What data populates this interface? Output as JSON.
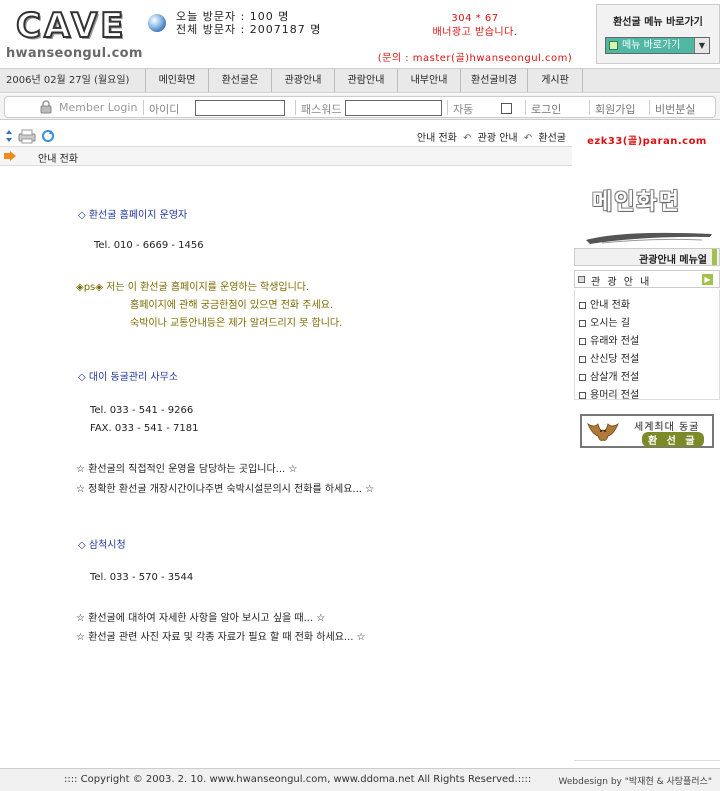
{
  "header": {
    "logo_text": "CAVE",
    "logo_domain": "hwanseongul.com",
    "visitors": {
      "today_label": "오늘 방문자 : ",
      "today_value": "100 명",
      "total_label": "전체 방문자 : ",
      "total_value": "2007187 명"
    },
    "ad": {
      "size": "304 * 67",
      "text": "배너광고 받습니다.",
      "contact": "(문의 : master(골)hwanseongul.com)"
    },
    "menu_shortcut": {
      "title": "환선굴 메뉴 바로가기",
      "selected": "메뉴 바로가기"
    }
  },
  "nav": {
    "date": "2006년 02월 27일 (월요일)",
    "items": [
      "메인화면",
      "환선굴은",
      "관광안내",
      "관람안내",
      "내부안내",
      "환선굴비경",
      "게시판"
    ]
  },
  "login": {
    "member": "Member",
    "login": " Login",
    "id_label": "아이디",
    "pw_label": "패스워드",
    "auto_label": "자동",
    "login_btn": "로그인",
    "join_btn": "회원가입",
    "find_pw_btn": "비번분실"
  },
  "breadcrumb": [
    "안내 전화",
    "관광 안내",
    "환선굴"
  ],
  "page_title": "안내 전화",
  "content": {
    "section1_title": "◇ 환선굴 홈페이지 운영자",
    "section1_tel": "Tel. 010 - 6669 - 1456",
    "ps_line1": "◈ps◈  저는 이 환선굴 홈페이지를 운영하는 학생입니다.",
    "ps_line2": "홈페이지에 관해 궁금한점이 있으면 전화 주세요.",
    "ps_line3": "숙박이나 교통안내등은 제가 알려드리지 못 합니다.",
    "section2_title": "◇ 대이 동굴관리 사무소",
    "section2_tel": "Tel. 033 - 541 - 9266",
    "section2_fax": "FAX. 033 - 541 - 7181",
    "section2_note1": "☆ 환선굴의 직접적인 운영을 담당하는 곳입니다... ☆",
    "section2_note2": "☆ 정확한 환선굴 개장시간이나주변 숙박시설문의시 전화를 하세요... ☆",
    "section3_title": "◇ 삼척시청",
    "section3_tel": "Tel. 033 - 570 - 3544",
    "section3_note1": "☆ 환선굴에 대하여 자세한 사항을 알아 보시고 싶을 때... ☆",
    "section3_note2": "☆ 환선굴 관련 사진 자료 및 각종 자료가 필요 할 때 전화 하세요... ☆"
  },
  "sidebar": {
    "email": "ezk33(골)paran.com",
    "main_screen": "메인화면",
    "tour_menu": "관광안내 메뉴얼",
    "section": "관 광 안 내",
    "items": [
      "안내 전화",
      "오시는 길",
      "유래와 전설",
      "산신당 전설",
      "삼살개 전설",
      "용머리 전설"
    ],
    "largest_cave": "세계최대 동굴",
    "cave_name": "환 선 굴"
  },
  "footer": {
    "copyright": ":::: Copyright © 2003. 2. 10. www.hwanseongul.com, www.ddoma.net All Rights Reserved.::::",
    "webdesign": "Webdesign by \"박재현 & 사탕플러스\""
  },
  "colors": {
    "nav_bg": "#e9e9e9",
    "ad_red": "#dd1111",
    "link_blue": "#2236a0",
    "olive": "#7b6a00",
    "menu_green": "#4fb8a2"
  }
}
